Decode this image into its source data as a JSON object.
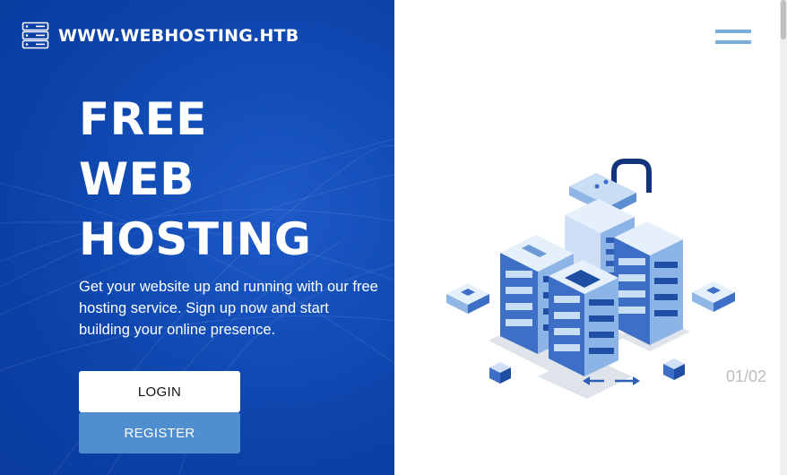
{
  "brand": {
    "name": "WWW.WEBHOSTING.HTB",
    "icon": "server-stack-icon"
  },
  "hero": {
    "headline": [
      "FREE",
      "WEB",
      "HOSTING"
    ],
    "tagline": "Get your website up and running with our free hosting service. Sign up now and start building your online presence."
  },
  "buttons": {
    "login": "LOGIN",
    "register": "REGISTER"
  },
  "nav": {
    "menu_icon": "hamburger-menu-icon"
  },
  "illustration": {
    "icon": "isometric-server-cluster-illustration"
  },
  "slider": {
    "pager": "01/02"
  },
  "colors": {
    "panel_blue": "#0b40a6",
    "register_blue": "#4f8ecf",
    "menu_blue": "#78aedc",
    "pager_gray": "#b9bcc1"
  }
}
